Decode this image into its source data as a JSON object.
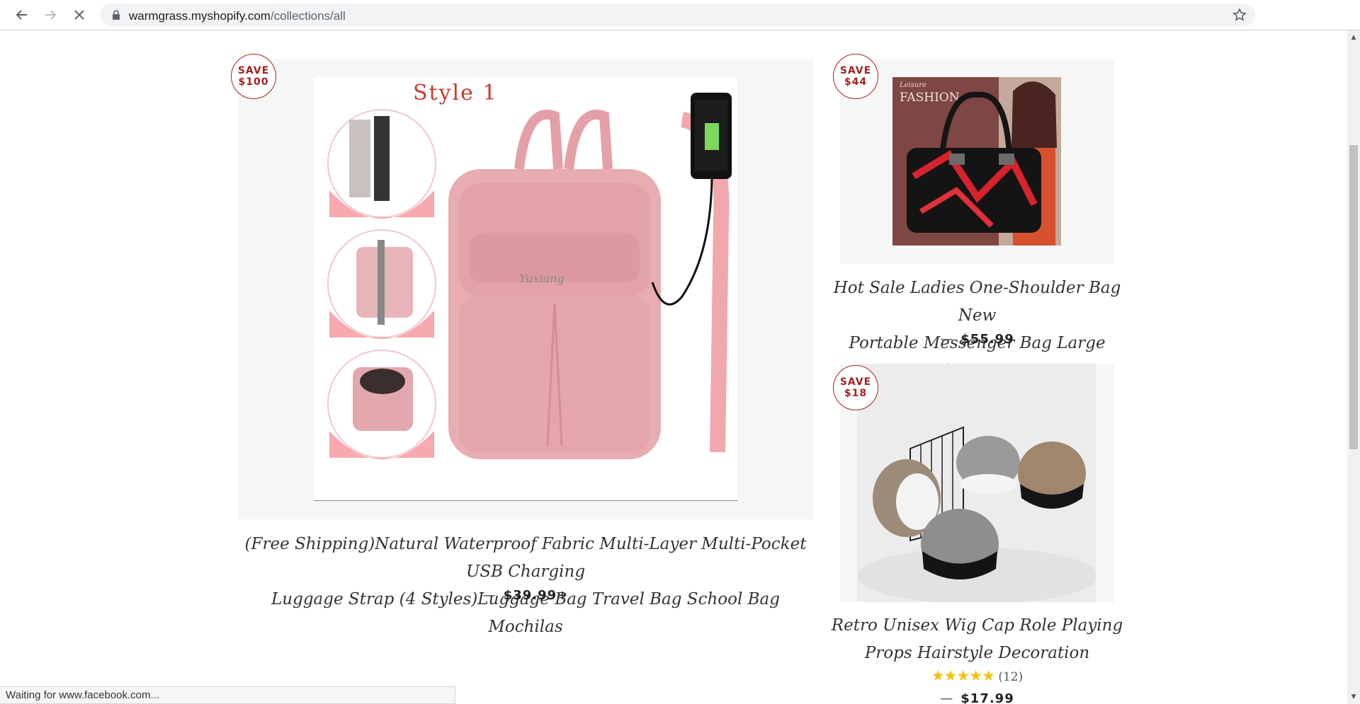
{
  "browser": {
    "url_domain": "warmgrass.myshopify.com",
    "url_path": "/collections/all",
    "status_text": "Waiting for www.facebook.com..."
  },
  "products": [
    {
      "badge_line1": "SAVE",
      "badge_line2": "$100",
      "image_caption": "Style 1",
      "title_line1": "(Free Shipping)Natural Waterproof Fabric Multi-Layer Multi-Pocket USB Charging",
      "title_line2": "Luggage Strap (4 Styles)Luggage Bag Travel Bag School Bag Mochilas",
      "dash": "—",
      "price": "$39.99",
      "price_suffix": "+"
    },
    {
      "badge_line1": "SAVE",
      "badge_line2": "$44",
      "image_caption_small": "Leisure",
      "image_caption": "FASHION",
      "title_line1": "Hot Sale Ladies One-Shoulder Bag New",
      "title_line2": "Portable Messenger Bag Large Capacity",
      "dash": "—",
      "price": "$55.99"
    },
    {
      "badge_line1": "SAVE",
      "badge_line2": "$18",
      "title_line1": "Retro Unisex Wig Cap Role Playing",
      "title_line2": "Props Hairstyle Decoration",
      "rating_stars": 5,
      "rating_count": "(12)",
      "dash": "—",
      "price": "$17.99"
    }
  ]
}
